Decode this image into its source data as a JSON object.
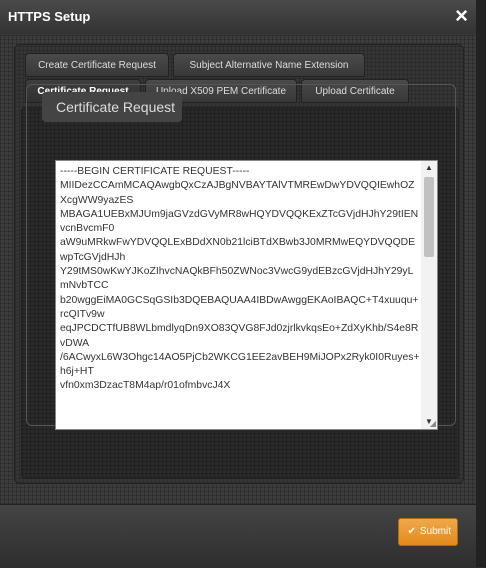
{
  "dialog": {
    "title": "HTTPS Setup",
    "close_icon": "×"
  },
  "tabs": [
    {
      "label": "Create Certificate Request",
      "active": false
    },
    {
      "label": "Subject Alternative Name Extension",
      "active": false
    },
    {
      "label": "Certificate Request",
      "active": true
    },
    {
      "label": "Upload X509 PEM Certificate",
      "active": false
    },
    {
      "label": "Upload Certificate",
      "active": false
    }
  ],
  "panel": {
    "legend": "Certificate Request",
    "certificate_text": "-----BEGIN CERTIFICATE REQUEST-----\nMIIDezCCAmMCAQAwgbQxCzAJBgNVBAYTAlVTMREwDwYDVQQIEwhOZXcgWW9yazES\nMBAGA1UEBxMJUm9jaGVzdGVyMR8wHQYDVQQKExZTcGVjdHJhY29tIENvcnBvcmF0\naW9uMRkwFwYDVQQLExBDdXN0b21lciBTdXBwb3J0MRMwEQYDVQQDEwpTcGVjdHJh\nY29tMS0wKwYJKoZIhvcNAQkBFh50ZWNoc3VwcG9ydEBzcGVjdHJhY29yLmNvbTCC\nb20wggEiMA0GCSqGSIb3DQEBAQUAA4IBDwAwggEKAoIBAQC+T4xuuqu+rcQITv9w\neqJPCDCTfUB8WLbmdlyqDn9XO83QVG8FJd0zjrlkvkqsEo+ZdXyKhb/S4e8RvDWA\n/6ACwyxL6W3Ohgc14AO5PjCb2WKCG1EE2avBEH9MiJOPx2Ryk0I0Ruyes+h6j+HT\nvfn0xm3DzacT8M4ap/r01ofmbvcJ4X"
  },
  "footer": {
    "submit_label": "Submit",
    "submit_icon": "check-icon"
  }
}
